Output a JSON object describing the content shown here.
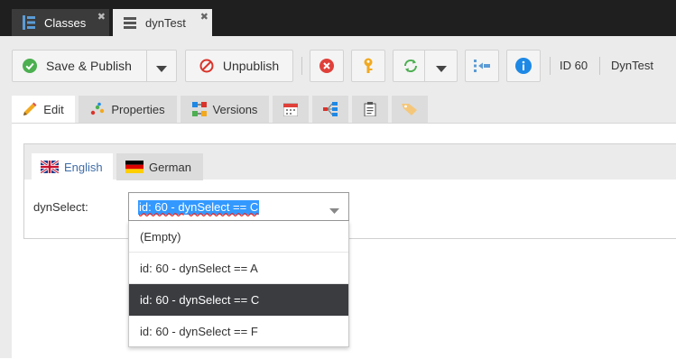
{
  "top_tabs": [
    {
      "label": "Classes",
      "close": "✖"
    },
    {
      "label": "dynTest",
      "close": "✖"
    }
  ],
  "toolbar": {
    "save_publish": "Save & Publish",
    "unpublish": "Unpublish",
    "id_text": "ID 60",
    "name_text": "DynTest"
  },
  "sub_tabs": {
    "edit": "Edit",
    "properties": "Properties",
    "versions": "Versions"
  },
  "lang_tabs": {
    "english": "English",
    "german": "German"
  },
  "field": {
    "label": "dynSelect:",
    "value": "id: 60 - dynSelect == C"
  },
  "dropdown": {
    "options": [
      "(Empty)",
      "id: 60 - dynSelect == A",
      "id: 60 - dynSelect == C",
      "id: 60 - dynSelect == F"
    ],
    "selected": "id: 60 - dynSelect == C"
  },
  "colors": {
    "topbar": "#1f1f1f",
    "accent_blue": "#3399ff",
    "selected_option_bg": "#3a3c40",
    "unpublish_red": "#d9342b",
    "publish_green": "#4caf50"
  }
}
